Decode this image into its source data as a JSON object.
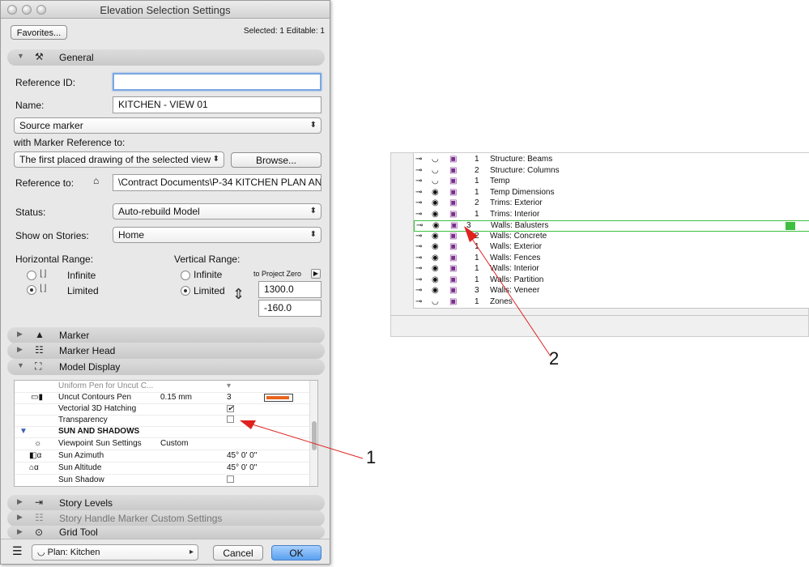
{
  "dialog": {
    "title": "Elevation Selection Settings",
    "favorites_label": "Favorites...",
    "selection_info": "Selected: 1 Editable: 1",
    "general": {
      "title": "General",
      "reference_id_label": "Reference ID:",
      "reference_id_value": "",
      "name_label": "Name:",
      "name_value": "KITCHEN - VIEW 01",
      "source_marker": "Source marker",
      "marker_ref_label": "with Marker Reference to:",
      "marker_ref_value": "The first placed drawing of the selected view",
      "browse_label": "Browse...",
      "reference_to_label": "Reference to:",
      "reference_to_value": "\\Contract Documents\\P-34 KITCHEN PLAN ANI",
      "status_label": "Status:",
      "status_value": "Auto-rebuild Model",
      "stories_label": "Show on Stories:",
      "stories_value": "Home",
      "horizontal_range_label": "Horizontal Range:",
      "horizontal_infinite": "Infinite",
      "horizontal_limited": "Limited",
      "vertical_range_label": "Vertical Range:",
      "vertical_infinite": "Infinite",
      "vertical_limited": "Limited",
      "to_project_zero": "to Project Zero",
      "upper_value": "1300.0",
      "lower_value": "-160.0"
    },
    "sections": {
      "marker": "Marker",
      "marker_head": "Marker Head",
      "model_display": "Model Display",
      "story_levels": "Story Levels",
      "story_handle": "Story Handle Marker Custom Settings",
      "grid_tool": "Grid Tool"
    },
    "model_table": {
      "cut_row": "Uniform Pen for Uncut C...",
      "uncut_pen_label": "Uncut Contours Pen",
      "uncut_pen_size": "0.15 mm",
      "uncut_pen_num": "3",
      "pen_color": "#e8641e",
      "vectorial_label": "Vectorial 3D Hatching",
      "transparency_label": "Transparency",
      "sun_group": "SUN AND SHADOWS",
      "viewpoint_label": "Viewpoint Sun Settings",
      "viewpoint_value": "Custom",
      "azimuth_label": "Sun Azimuth",
      "azimuth_value": "45° 0' 0\"",
      "altitude_label": "Sun Altitude",
      "altitude_value": "45° 0' 0\"",
      "shadow_label": "Sun Shadow"
    },
    "footer": {
      "view_value": "Plan: Kitchen",
      "cancel_label": "Cancel",
      "ok_label": "OK"
    }
  },
  "layers": [
    {
      "num": "1",
      "name": "Structure: Beams"
    },
    {
      "num": "2",
      "name": "Structure: Columns"
    },
    {
      "num": "1",
      "name": "Temp"
    },
    {
      "num": "1",
      "name": "Temp Dimensions"
    },
    {
      "num": "2",
      "name": "Trims: Exterior"
    },
    {
      "num": "1",
      "name": "Trims: Interior"
    },
    {
      "num": "3",
      "name": "Walls: Balusters"
    },
    {
      "num": "2",
      "name": "Walls: Concrete"
    },
    {
      "num": "1",
      "name": "Walls: Exterior"
    },
    {
      "num": "1",
      "name": "Walls: Fences"
    },
    {
      "num": "1",
      "name": "Walls: Interior"
    },
    {
      "num": "1",
      "name": "Walls: Partition"
    },
    {
      "num": "3",
      "name": "Walls: Veneer"
    },
    {
      "num": "1",
      "name": "Zones"
    }
  ],
  "callouts": {
    "one": "1",
    "two": "2"
  },
  "colors": {
    "selected_row": "#3fbf3f",
    "arrow": "#e0221f",
    "layer_icon": "#7a2e8c"
  }
}
